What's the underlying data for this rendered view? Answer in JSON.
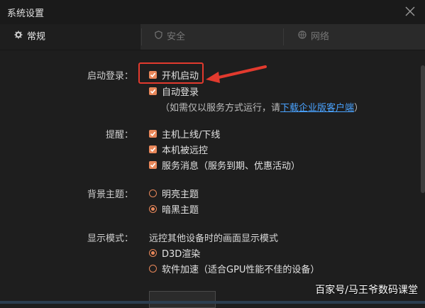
{
  "window": {
    "title": "系统设置"
  },
  "tabs": [
    {
      "label": "常规",
      "icon": "gear-icon"
    },
    {
      "label": "安全",
      "icon": "shield-icon"
    },
    {
      "label": "网络",
      "icon": "globe-icon"
    }
  ],
  "startup": {
    "label": "启动登录：",
    "boot_start": "开机启动",
    "auto_login": "自动登录",
    "note_prefix": "（如需仅以服务方式运行，请",
    "note_link": "下载企业版客户端",
    "note_suffix": "）"
  },
  "reminder": {
    "label": "提醒：",
    "items": [
      "主机上线/下线",
      "本机被远控",
      "服务消息（服务到期、优惠活动）"
    ]
  },
  "theme": {
    "label": "背景主题：",
    "options": [
      "明亮主题",
      "暗黑主题"
    ],
    "selected": "暗黑主题"
  },
  "display": {
    "label": "显示模式：",
    "desc": "远控其他设备时的画面显示模式",
    "options": [
      "D3D渲染",
      "软件加速（适合GPU性能不佳的设备）"
    ],
    "selected": "D3D渲染"
  },
  "watermark": "百家号/马王爷数码课堂",
  "colors": {
    "accent": "#e8875a",
    "link": "#4aa3ff",
    "highlight": "#e23a2e"
  }
}
